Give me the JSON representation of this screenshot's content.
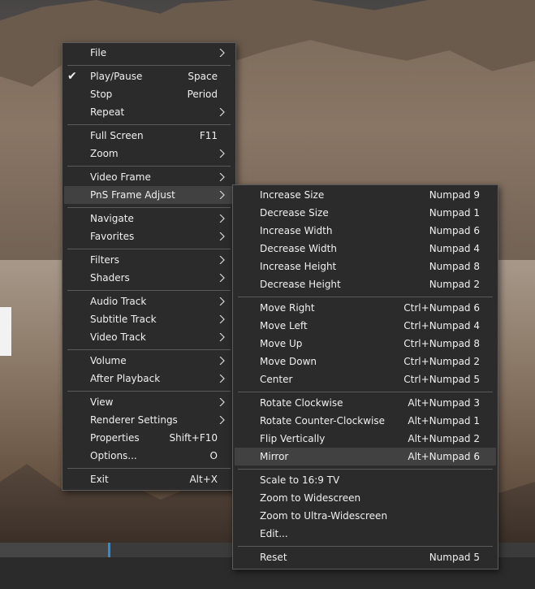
{
  "main_menu": {
    "items": [
      {
        "label": "File",
        "shortcut": "",
        "submenu": true
      },
      {
        "label": "Play/Pause",
        "shortcut": "Space",
        "submenu": false,
        "checked": true
      },
      {
        "label": "Stop",
        "shortcut": "Period",
        "submenu": false
      },
      {
        "label": "Repeat",
        "shortcut": "",
        "submenu": true
      },
      {
        "label": "Full Screen",
        "shortcut": "F11",
        "submenu": false
      },
      {
        "label": "Zoom",
        "shortcut": "",
        "submenu": true
      },
      {
        "label": "Video Frame",
        "shortcut": "",
        "submenu": true
      },
      {
        "label": "PnS Frame Adjust",
        "shortcut": "",
        "submenu": true,
        "highlighted": true
      },
      {
        "label": "Navigate",
        "shortcut": "",
        "submenu": true
      },
      {
        "label": "Favorites",
        "shortcut": "",
        "submenu": true
      },
      {
        "label": "Filters",
        "shortcut": "",
        "submenu": true
      },
      {
        "label": "Shaders",
        "shortcut": "",
        "submenu": true
      },
      {
        "label": "Audio Track",
        "shortcut": "",
        "submenu": true
      },
      {
        "label": "Subtitle Track",
        "shortcut": "",
        "submenu": true
      },
      {
        "label": "Video Track",
        "shortcut": "",
        "submenu": true
      },
      {
        "label": "Volume",
        "shortcut": "",
        "submenu": true
      },
      {
        "label": "After Playback",
        "shortcut": "",
        "submenu": true
      },
      {
        "label": "View",
        "shortcut": "",
        "submenu": true
      },
      {
        "label": "Renderer Settings",
        "shortcut": "",
        "submenu": true
      },
      {
        "label": "Properties",
        "shortcut": "Shift+F10",
        "submenu": false
      },
      {
        "label": "Options...",
        "shortcut": "O",
        "submenu": false
      },
      {
        "label": "Exit",
        "shortcut": "Alt+X",
        "submenu": false
      }
    ],
    "check_glyph": "✔"
  },
  "pns_submenu": {
    "items": [
      {
        "label": "Increase Size",
        "shortcut": "Numpad 9"
      },
      {
        "label": "Decrease Size",
        "shortcut": "Numpad 1"
      },
      {
        "label": "Increase Width",
        "shortcut": "Numpad 6"
      },
      {
        "label": "Decrease Width",
        "shortcut": "Numpad 4"
      },
      {
        "label": "Increase Height",
        "shortcut": "Numpad 8"
      },
      {
        "label": "Decrease Height",
        "shortcut": "Numpad 2"
      },
      {
        "label": "Move Right",
        "shortcut": "Ctrl+Numpad 6"
      },
      {
        "label": "Move Left",
        "shortcut": "Ctrl+Numpad 4"
      },
      {
        "label": "Move Up",
        "shortcut": "Ctrl+Numpad 8"
      },
      {
        "label": "Move Down",
        "shortcut": "Ctrl+Numpad 2"
      },
      {
        "label": "Center",
        "shortcut": "Ctrl+Numpad 5"
      },
      {
        "label": "Rotate Clockwise",
        "shortcut": "Alt+Numpad 3"
      },
      {
        "label": "Rotate Counter-Clockwise",
        "shortcut": "Alt+Numpad 1"
      },
      {
        "label": "Flip Vertically",
        "shortcut": "Alt+Numpad 2"
      },
      {
        "label": "Mirror",
        "shortcut": "Alt+Numpad 6",
        "highlighted": true
      },
      {
        "label": "Scale to 16:9 TV",
        "shortcut": ""
      },
      {
        "label": "Zoom to Widescreen",
        "shortcut": ""
      },
      {
        "label": "Zoom to Ultra-Widescreen",
        "shortcut": ""
      },
      {
        "label": "Edit...",
        "shortcut": ""
      },
      {
        "label": "Reset",
        "shortcut": "Numpad 5"
      }
    ]
  },
  "colors": {
    "menu_bg": "#2b2b2b",
    "menu_highlight": "#414141",
    "seek_thumb": "#2a8fd6"
  }
}
